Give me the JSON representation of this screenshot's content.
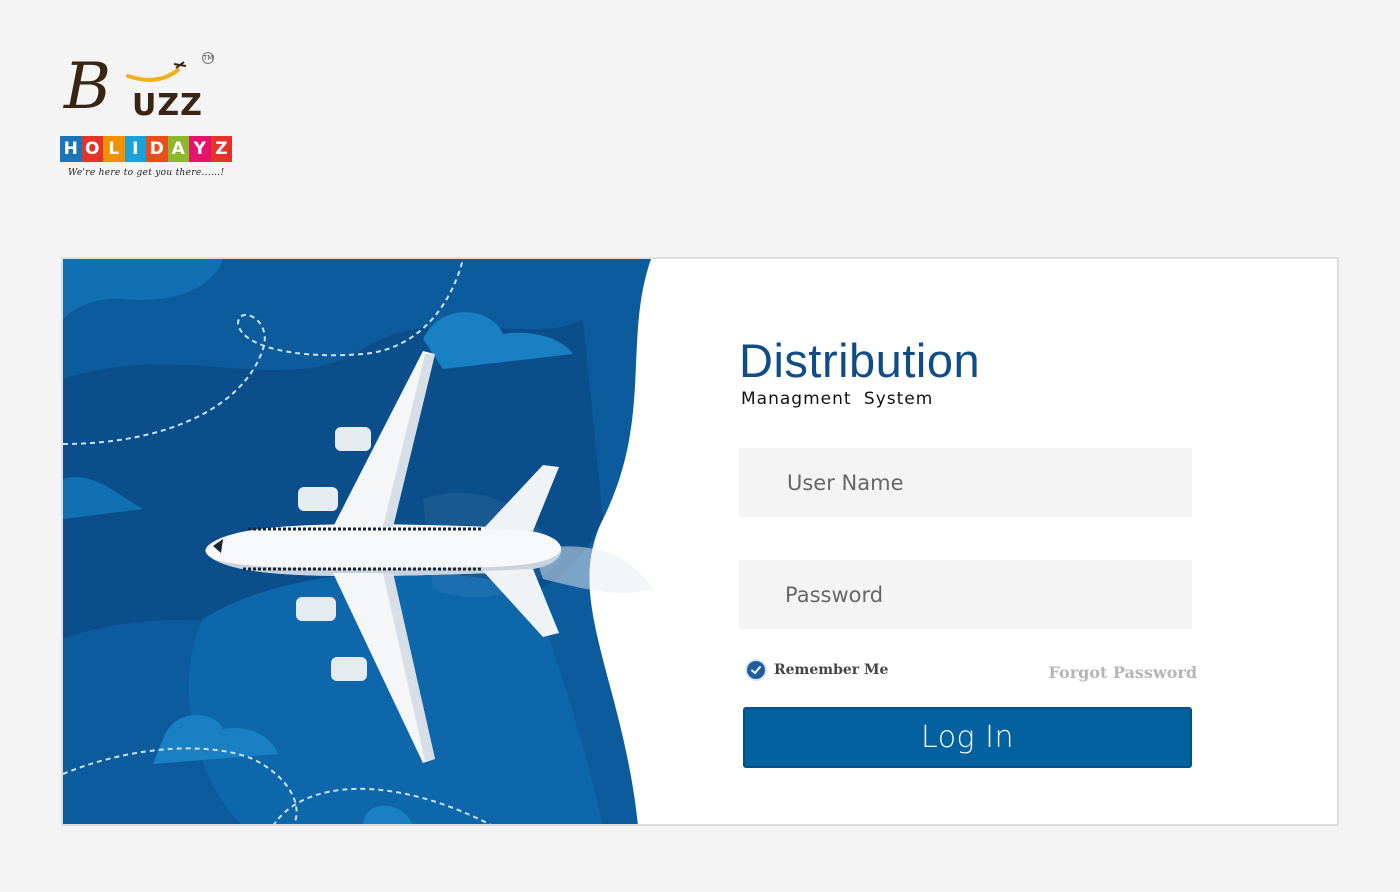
{
  "brand": {
    "logo_initial": "B",
    "logo_word": "UZZ",
    "trademark": "TM",
    "sub_letters": [
      "H",
      "O",
      "L",
      "I",
      "D",
      "A",
      "Y",
      "Z"
    ],
    "sub_colors": [
      "#1b74b8",
      "#e6332a",
      "#f39200",
      "#1ba1d9",
      "#e94e1b",
      "#8cb82b",
      "#e3136e",
      "#e6332a"
    ],
    "tagline": "We're here to get you there......!"
  },
  "login": {
    "title": "Distribution",
    "subtitle": "Managment  System",
    "username_placeholder": "User Name",
    "password_placeholder": "Password",
    "remember_label": "Remember Me",
    "remember_checked": true,
    "forgot_label": "Forgot Password",
    "login_label": "Log In"
  },
  "colors": {
    "primary": "#01629f",
    "title": "#104d86",
    "hero_bg": "#0c5b9c"
  }
}
